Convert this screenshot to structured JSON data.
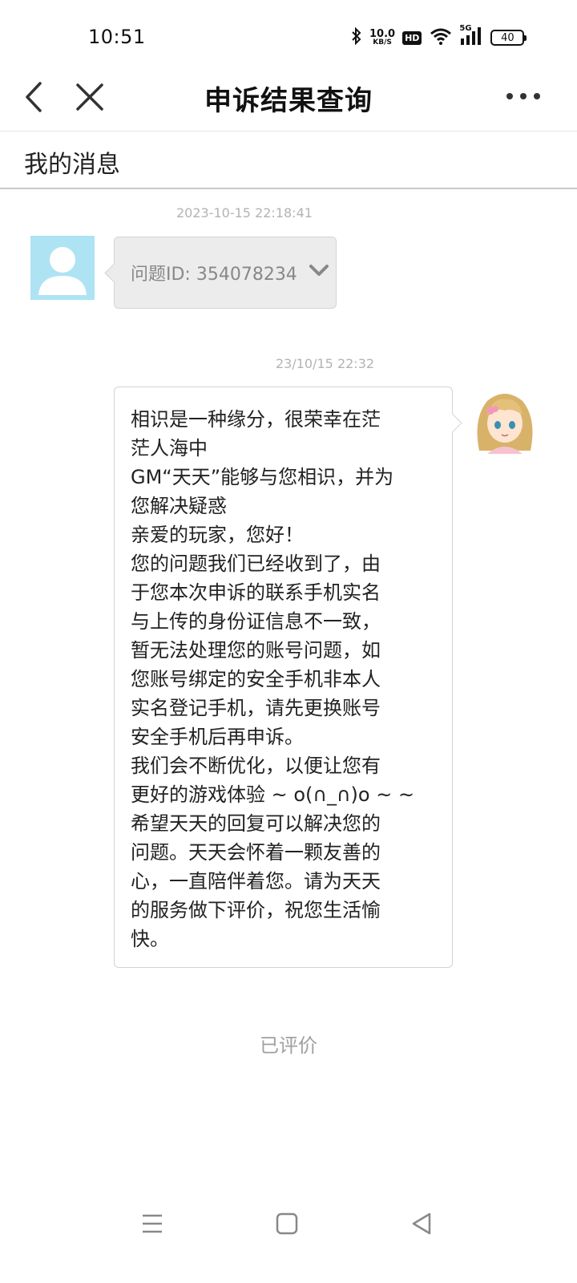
{
  "status_bar": {
    "time": "10:51",
    "net_speed_value": "10.0",
    "net_speed_unit": "KB/S",
    "hd_label": "HD",
    "signal_label": "5G",
    "battery_level": "40"
  },
  "nav": {
    "title": "申诉结果查询"
  },
  "section": {
    "title": "我的消息"
  },
  "messages": [
    {
      "timestamp": "2023-10-15 22:18:41",
      "sender": "user",
      "text": "问题ID: 354078234"
    },
    {
      "timestamp": "23/10/15 22:32",
      "sender": "gm",
      "lines": [
        "相识是一种缘分，很荣幸在茫",
        "茫人海中",
        "GM“天天”能够与您相识，并为",
        "您解决疑惑",
        "亲爱的玩家，您好！",
        "您的问题我们已经收到了，由",
        "于您本次申诉的联系手机实名",
        "与上传的身份证信息不一致，",
        "暂无法处理您的账号问题，如",
        "您账号绑定的安全手机非本人",
        "实名登记手机，请先更换账号",
        "安全手机后再申诉。",
        "我们会不断优化，以便让您有",
        "更好的游戏体验 ~ o(∩_∩)o ~ ~",
        "希望天天的回复可以解决您的",
        "问题。天天会怀着一颗友善的",
        "心，一直陪伴着您。请为天天",
        "的服务做下评价，祝您生活愉",
        "快。"
      ]
    }
  ],
  "footer": {
    "rated_label": "已评价"
  },
  "colors": {
    "user_avatar_bg": "#aee3f4",
    "left_bubble_bg": "#ececec",
    "timestamp_text": "#b3b3b3"
  }
}
